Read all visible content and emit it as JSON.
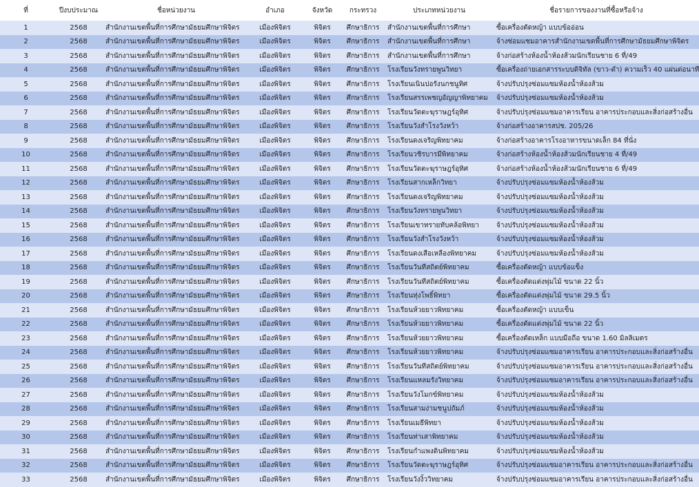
{
  "headers": [
    "ที่",
    "ปีงบประมาณ",
    "ชื่อหน่วยงาน",
    "อำเภอ",
    "จังหวัด",
    "กระทรวง",
    "ประเภทหน่วยงาน",
    "ชื่อรายการของงานที่ซื้อหรือจ้าง"
  ],
  "rows": [
    [
      "1",
      "2568",
      "สำนักงานเขตพื้นที่การศึกษามัธยมศึกษาพิจิตร",
      "เมืองพิจิตร",
      "พิจิตร",
      "ศึกษาธิการ",
      "สำนักงานเขตพื้นที่การศึกษา",
      "ซื้อเครื่องตัดหญ้า แบบข้ออ่อน"
    ],
    [
      "2",
      "2568",
      "สำนักงานเขตพื้นที่การศึกษามัธยมศึกษาพิจิตร",
      "เมืองพิจิตร",
      "พิจิตร",
      "ศึกษาธิการ",
      "สำนักงานเขตพื้นที่การศึกษา",
      "จ้างซ่อมแซมอาคารสำนักงานเขตพื้นที่การศึกษามัธยมศึกษาพิจิตร"
    ],
    [
      "3",
      "2568",
      "สำนักงานเขตพื้นที่การศึกษามัธยมศึกษาพิจิตร",
      "เมืองพิจิตร",
      "พิจิตร",
      "ศึกษาธิการ",
      "สำนักงานเขตพื้นที่การศึกษา",
      "จ้างก่อสร้างห้องน้ำห้องส้วมนักเรียนชาย 6 ที่/49"
    ],
    [
      "4",
      "2568",
      "สำนักงานเขตพื้นที่การศึกษามัธยมศึกษาพิจิตร",
      "เมืองพิจิตร",
      "พิจิตร",
      "ศึกษาธิการ",
      "โรงเรียนวังทรายพูนวิทยา",
      "ซื้อเครื่องถ่ายเอกสารระบบดิจิทัล (ขาว-ดำ) ความเร็ว 40 แผ่นต่อนาที"
    ],
    [
      "5",
      "2568",
      "สำนักงานเขตพื้นที่การศึกษามัธยมศึกษาพิจิตร",
      "เมืองพิจิตร",
      "พิจิตร",
      "ศึกษาธิการ",
      "โรงเรียนเนินปอรังนกชนูทิศ",
      "จ้างปรับปรุงซ่อมแซมห้องน้ำห้องส้วม"
    ],
    [
      "6",
      "2568",
      "สำนักงานเขตพื้นที่การศึกษามัธยมศึกษาพิจิตร",
      "เมืองพิจิตร",
      "พิจิตร",
      "ศึกษาธิการ",
      "โรงเรียนสรรเพชญอัญญาพิทยาคม",
      "จ้างปรับปรุงซ่อมแซมห้องน้ำห้องส้วม"
    ],
    [
      "7",
      "2568",
      "สำนักงานเขตพื้นที่การศึกษามัธยมศึกษาพิจิตร",
      "เมืองพิจิตร",
      "พิจิตร",
      "ศึกษาธิการ",
      "โรงเรียนวัดตะฆุราษฎร์อุทิศ",
      "จ้างปรับปรุงซ่อมแซมอาคารเรียน อาคารประกอบและสิ่งก่อสร้างอื่น"
    ],
    [
      "8",
      "2568",
      "สำนักงานเขตพื้นที่การศึกษามัธยมศึกษาพิจิตร",
      "เมืองพิจิตร",
      "พิจิตร",
      "ศึกษาธิการ",
      "โรงเรียนวังสำโรงวังหว้า",
      "จ้างก่อสร้างอาคารสปช. 205/26"
    ],
    [
      "9",
      "2568",
      "สำนักงานเขตพื้นที่การศึกษามัธยมศึกษาพิจิตร",
      "เมืองพิจิตร",
      "พิจิตร",
      "ศึกษาธิการ",
      "โรงเรียนดงเจริญพิทยาคม",
      "จ้างก่อสร้างอาคารโรงอาหารขนาดเล็ก 84 ที่นั่ง"
    ],
    [
      "10",
      "2568",
      "สำนักงานเขตพื้นที่การศึกษามัธยมศึกษาพิจิตร",
      "เมืองพิจิตร",
      "พิจิตร",
      "ศึกษาธิการ",
      "โรงเรียนวชิรบารมีพิทยาคม",
      "จ้างก่อสร้างห้องน้ำห้องส้วมนักเรียนชาย 4 ที่/49"
    ],
    [
      "11",
      "2568",
      "สำนักงานเขตพื้นที่การศึกษามัธยมศึกษาพิจิตร",
      "เมืองพิจิตร",
      "พิจิตร",
      "ศึกษาธิการ",
      "โรงเรียนวัดตะฆุราษฎร์อุทิศ",
      "จ้างก่อสร้างห้องน้ำห้องส้วมนักเรียนชาย 6 ที่/49"
    ],
    [
      "12",
      "2568",
      "สำนักงานเขตพื้นที่การศึกษามัธยมศึกษาพิจิตร",
      "เมืองพิจิตร",
      "พิจิตร",
      "ศึกษาธิการ",
      "โรงเรียนสากเหล็กวิทยา",
      "จ้างปรับปรุงซ่อมแซมห้องน้ำห้องส้วม"
    ],
    [
      "13",
      "2568",
      "สำนักงานเขตพื้นที่การศึกษามัธยมศึกษาพิจิตร",
      "เมืองพิจิตร",
      "พิจิตร",
      "ศึกษาธิการ",
      "โรงเรียนดงเจริญพิทยาคม",
      "จ้างปรับปรุงซ่อมแซมห้องน้ำห้องส้วม"
    ],
    [
      "14",
      "2568",
      "สำนักงานเขตพื้นที่การศึกษามัธยมศึกษาพิจิตร",
      "เมืองพิจิตร",
      "พิจิตร",
      "ศึกษาธิการ",
      "โรงเรียนวังทรายพูนวิทยา",
      "จ้างปรับปรุงซ่อมแซมห้องน้ำห้องส้วม"
    ],
    [
      "15",
      "2568",
      "สำนักงานเขตพื้นที่การศึกษามัธยมศึกษาพิจิตร",
      "เมืองพิจิตร",
      "พิจิตร",
      "ศึกษาธิการ",
      "โรงเรียนเขาทรายทับคล้อพิทยา",
      "จ้างปรับปรุงซ่อมแซมห้องน้ำห้องส้วม"
    ],
    [
      "16",
      "2568",
      "สำนักงานเขตพื้นที่การศึกษามัธยมศึกษาพิจิตร",
      "เมืองพิจิตร",
      "พิจิตร",
      "ศึกษาธิการ",
      "โรงเรียนวังสำโรงวังหว้า",
      "จ้างปรับปรุงซ่อมแซมห้องน้ำห้องส้วม"
    ],
    [
      "17",
      "2568",
      "สำนักงานเขตพื้นที่การศึกษามัธยมศึกษาพิจิตร",
      "เมืองพิจิตร",
      "พิจิตร",
      "ศึกษาธิการ",
      "โรงเรียนดงเสือเหลืองพิทยาคม",
      "จ้างปรับปรุงซ่อมแซมห้องน้ำห้องส้วม"
    ],
    [
      "18",
      "2568",
      "สำนักงานเขตพื้นที่การศึกษามัธยมศึกษาพิจิตร",
      "เมืองพิจิตร",
      "พิจิตร",
      "ศึกษาธิการ",
      "โรงเรียนวันทีสถิตย์พิทยาคม",
      "ซื้อเครื่องตัดหญ้า แบบข้อแข็ง"
    ],
    [
      "19",
      "2568",
      "สำนักงานเขตพื้นที่การศึกษามัธยมศึกษาพิจิตร",
      "เมืองพิจิตร",
      "พิจิตร",
      "ศึกษาธิการ",
      "โรงเรียนวันทีสถิตย์พิทยาคม",
      "ซื้อเครื่องตัดแต่งพุ่มไม้ ขนาด 22 นิ้ว"
    ],
    [
      "20",
      "2568",
      "สำนักงานเขตพื้นที่การศึกษามัธยมศึกษาพิจิตร",
      "เมืองพิจิตร",
      "พิจิตร",
      "ศึกษาธิการ",
      "โรงเรียนทุ่งโพธิ์พิทยา",
      "ซื้อเครื่องตัดแต่งพุ่มไม้ ขนาด 29.5 นิ้ว"
    ],
    [
      "21",
      "2568",
      "สำนักงานเขตพื้นที่การศึกษามัธยมศึกษาพิจิตร",
      "เมืองพิจิตร",
      "พิจิตร",
      "ศึกษาธิการ",
      "โรงเรียนห้วยยาวพิทยาคม",
      "ซื้อเครื่องตัดหญ้า แบบเข็น"
    ],
    [
      "22",
      "2568",
      "สำนักงานเขตพื้นที่การศึกษามัธยมศึกษาพิจิตร",
      "เมืองพิจิตร",
      "พิจิตร",
      "ศึกษาธิการ",
      "โรงเรียนห้วยยาวพิทยาคม",
      "ซื้อเครื่องตัดแต่งพุ่มไม้ ขนาด 22 นิ้ว"
    ],
    [
      "23",
      "2568",
      "สำนักงานเขตพื้นที่การศึกษามัธยมศึกษาพิจิตร",
      "เมืองพิจิตร",
      "พิจิตร",
      "ศึกษาธิการ",
      "โรงเรียนห้วยยาวพิทยาคม",
      "ซื้อเครื่องตัดเหล็ก แบบมือถือ ขนาด 1.60 มิลลิเมตร"
    ],
    [
      "24",
      "2568",
      "สำนักงานเขตพื้นที่การศึกษามัธยมศึกษาพิจิตร",
      "เมืองพิจิตร",
      "พิจิตร",
      "ศึกษาธิการ",
      "โรงเรียนห้วยยาวพิทยาคม",
      "จ้างปรับปรุงซ่อมแซมอาคารเรียน อาคารประกอบและสิ่งก่อสร้างอื่น"
    ],
    [
      "25",
      "2568",
      "สำนักงานเขตพื้นที่การศึกษามัธยมศึกษาพิจิตร",
      "เมืองพิจิตร",
      "พิจิตร",
      "ศึกษาธิการ",
      "โรงเรียนวันทีสถิตย์พิทยาคม",
      "จ้างปรับปรุงซ่อมแซมอาคารเรียน อาคารประกอบและสิ่งก่อสร้างอื่น"
    ],
    [
      "26",
      "2568",
      "สำนักงานเขตพื้นที่การศึกษามัธยมศึกษาพิจิตร",
      "เมืองพิจิตร",
      "พิจิตร",
      "ศึกษาธิการ",
      "โรงเรียนแหลมรังวิทยาคม",
      "จ้างปรับปรุงซ่อมแซมอาคารเรียน อาคารประกอบและสิ่งก่อสร้างอื่น"
    ],
    [
      "27",
      "2568",
      "สำนักงานเขตพื้นที่การศึกษามัธยมศึกษาพิจิตร",
      "เมืองพิจิตร",
      "พิจิตร",
      "ศึกษาธิการ",
      "โรงเรียนวังโมกข์พิทยาคม",
      "จ้างปรับปรุงซ่อมแซมห้องน้ำห้องส้วม"
    ],
    [
      "28",
      "2568",
      "สำนักงานเขตพื้นที่การศึกษามัธยมศึกษาพิจิตร",
      "เมืองพิจิตร",
      "พิจิตร",
      "ศึกษาธิการ",
      "โรงเรียนสามง่ามชนูปถัมภ์",
      "จ้างปรับปรุงซ่อมแซมห้องน้ำห้องส้วม"
    ],
    [
      "29",
      "2568",
      "สำนักงานเขตพื้นที่การศึกษามัธยมศึกษาพิจิตร",
      "เมืองพิจิตร",
      "พิจิตร",
      "ศึกษาธิการ",
      "โรงเรียนเมธีพิทยา",
      "จ้างปรับปรุงซ่อมแซมห้องน้ำห้องส้วม"
    ],
    [
      "30",
      "2568",
      "สำนักงานเขตพื้นที่การศึกษามัธยมศึกษาพิจิตร",
      "เมืองพิจิตร",
      "พิจิตร",
      "ศึกษาธิการ",
      "โรงเรียนท่าเสาพิทยาคม",
      "จ้างปรับปรุงซ่อมแซมห้องน้ำห้องส้วม"
    ],
    [
      "31",
      "2568",
      "สำนักงานเขตพื้นที่การศึกษามัธยมศึกษาพิจิตร",
      "เมืองพิจิตร",
      "พิจิตร",
      "ศึกษาธิการ",
      "โรงเรียนกำแพงดินพิทยาคม",
      "จ้างปรับปรุงซ่อมแซมห้องน้ำห้องส้วม"
    ],
    [
      "32",
      "2568",
      "สำนักงานเขตพื้นที่การศึกษามัธยมศึกษาพิจิตร",
      "เมืองพิจิตร",
      "พิจิตร",
      "ศึกษาธิการ",
      "โรงเรียนวัดตะฆุราษฎร์อุทิศ",
      "จ้างปรับปรุงซ่อมแซมอาคารเรียน อาคารประกอบและสิ่งก่อสร้างอื่น"
    ],
    [
      "33",
      "2568",
      "สำนักงานเขตพื้นที่การศึกษามัธยมศึกษาพิจิตร",
      "เมืองพิจิตร",
      "พิจิตร",
      "ศึกษาธิการ",
      "โรงเรียนวังงิ้ววิทยาคม",
      "จ้างปรับปรุงซ่อมแซมอาคารเรียน อาคารประกอบและสิ่งก่อสร้างอื่น"
    ]
  ]
}
